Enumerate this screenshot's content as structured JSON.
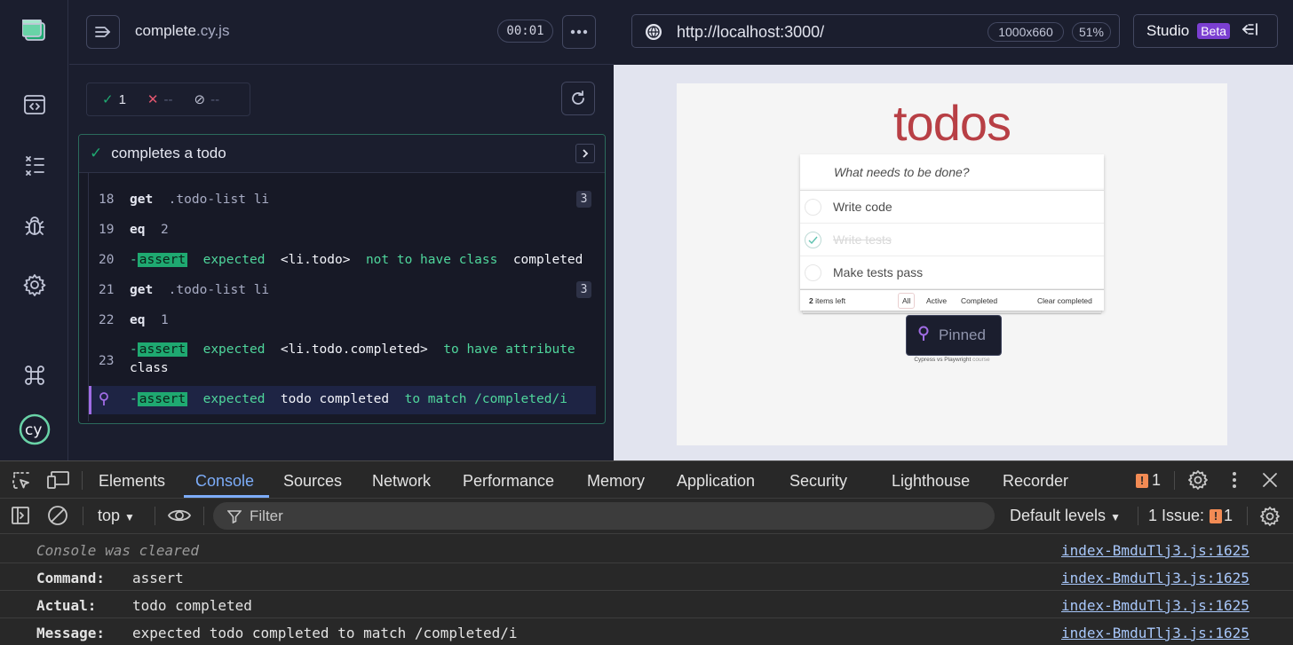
{
  "runner": {
    "spec_name": "complete",
    "spec_ext": ".cy.js",
    "timer": "00:01",
    "stats": {
      "passed": "1",
      "failed": "--",
      "pending": "--"
    },
    "test_title": "completes a todo",
    "commands": [
      {
        "num": "18",
        "name": "get",
        "arg": ".todo-list li",
        "badge": "3"
      },
      {
        "num": "19",
        "name": "eq",
        "arg": "2"
      },
      {
        "num": "20",
        "prefix": "-",
        "name": "assert",
        "parts": [
          "expected",
          "<li.todo>",
          "not to have class",
          "completed"
        ]
      },
      {
        "num": "21",
        "name": "get",
        "arg": ".todo-list li",
        "badge": "3"
      },
      {
        "num": "22",
        "name": "eq",
        "arg": "1"
      },
      {
        "num": "23",
        "prefix": "-",
        "name": "assert",
        "parts": [
          "expected",
          "<li.todo.completed>",
          "to have attribute",
          "class"
        ]
      },
      {
        "prefix": "-",
        "name": "assert",
        "parts": [
          "expected",
          "todo completed",
          "to match",
          "/completed/i"
        ]
      }
    ]
  },
  "browser": {
    "url": "http://localhost:3000/",
    "viewport_size": "1000x660",
    "zoom": "51%",
    "studio_label": "Studio",
    "studio_badge": "Beta"
  },
  "aut": {
    "heading": "todos",
    "placeholder": "What needs to be done?",
    "todos": [
      {
        "title": "Write code",
        "completed": false
      },
      {
        "title": "Write tests",
        "completed": true
      },
      {
        "title": "Make tests pass",
        "completed": false
      }
    ],
    "items_left_count": "2",
    "items_left_text": "items left",
    "filters": [
      "All",
      "Active",
      "Completed"
    ],
    "clear_completed": "Clear completed",
    "pinned_label": "Pinned",
    "credit_main": "Cypress vs Playwright",
    "credit_sub": "course"
  },
  "devtools": {
    "tabs": [
      "Elements",
      "Console",
      "Sources",
      "Network",
      "Performance",
      "Memory",
      "Application",
      "Security",
      "Lighthouse",
      "Recorder"
    ],
    "active_tab": "Console",
    "issues_badge": "1",
    "context": "top",
    "filter_placeholder": "Filter",
    "levels": "Default levels",
    "issues_label": "1 Issue:",
    "issues_count": "1",
    "console_lines": [
      {
        "text": "Console was cleared",
        "source": "index-BmduTlj3.js:1625"
      },
      {
        "key": "Command:",
        "value": "assert",
        "source": "index-BmduTlj3.js:1625"
      },
      {
        "key": "Actual:",
        "value": "todo completed",
        "source": "index-BmduTlj3.js:1625"
      },
      {
        "key": "Message:",
        "value": "expected todo completed to match /completed/i",
        "source": "index-BmduTlj3.js:1625"
      }
    ]
  },
  "colors": {
    "pass": "#1fa971",
    "fail": "#e45770",
    "pin": "#a06ce4",
    "todo_title": "#b83f45",
    "devtools_active": "#7cacf8"
  }
}
